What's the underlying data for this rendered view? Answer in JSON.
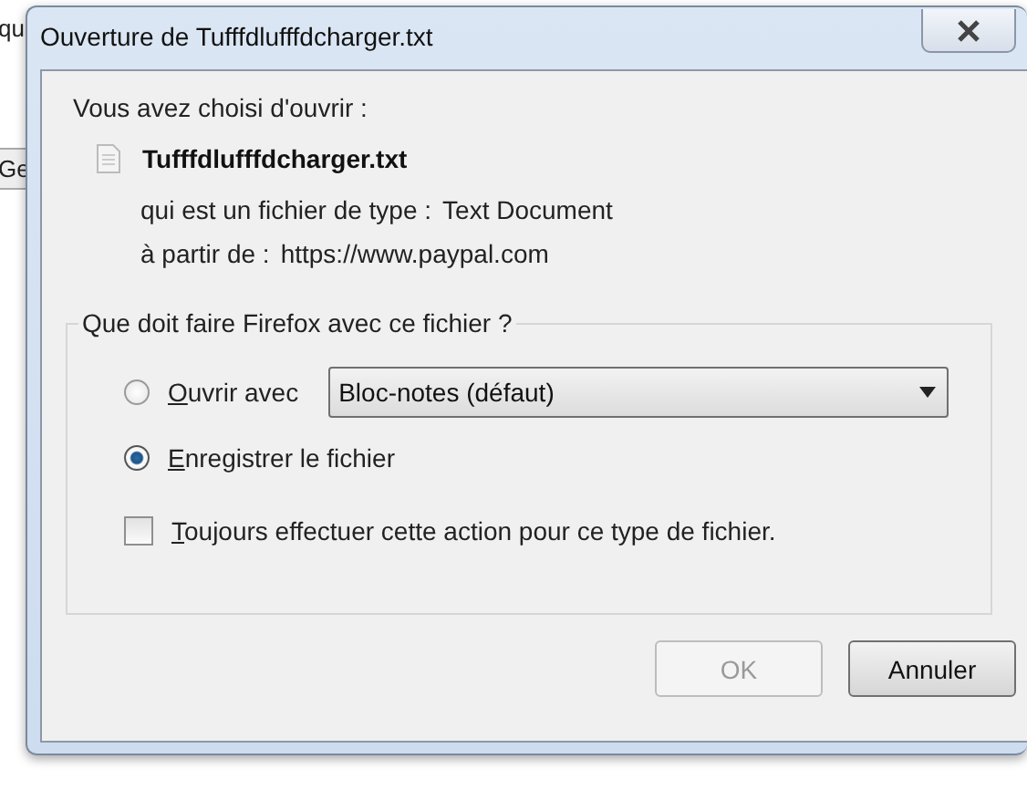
{
  "background_page": {
    "text_fragment": "qu",
    "button_fragment": "Ge"
  },
  "window": {
    "title": "Ouverture de Tufffdlufffdcharger.txt"
  },
  "intro": "Vous avez choisi d'ouvrir :",
  "file": {
    "name": "Tufffdlufffdcharger.txt",
    "type_label": "qui est un fichier de type :",
    "type_value": "Text Document",
    "source_label": "à partir de :",
    "source_value": "https://www.paypal.com"
  },
  "action_group": {
    "legend": "Que doit faire Firefox avec ce fichier ?",
    "options": [
      {
        "kind": "open",
        "label": "Ouvrir avec",
        "selected": false,
        "app": "Bloc-notes (défaut)"
      },
      {
        "kind": "save",
        "label": "Enregistrer le fichier",
        "selected": true
      }
    ],
    "always": {
      "label": "Toujours effectuer cette action pour ce type de fichier.",
      "checked": false
    }
  },
  "buttons": [
    {
      "label": "OK",
      "disabled": true
    },
    {
      "label": "Annuler",
      "disabled": false
    }
  ]
}
